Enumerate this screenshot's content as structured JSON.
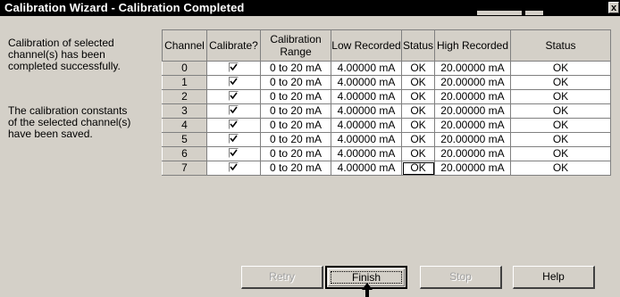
{
  "window": {
    "title": "Calibration Wizard - Calibration Completed",
    "close_glyph": "x"
  },
  "description": {
    "completed": "Calibration of selected\nchannel(s) has been\ncompleted successfully.",
    "saved": "The calibration constants\nof the selected channel(s)\nhave been saved."
  },
  "table": {
    "headers": [
      "Channel",
      "Calibrate?",
      "Calibration Range",
      "Low Recorded",
      "Status",
      "High Recorded",
      "Status"
    ],
    "rows": [
      {
        "channel": "0",
        "range": "0 to 20 mA",
        "low": "4.00000 mA",
        "low_status": "OK",
        "high": "20.00000 mA",
        "high_status": "OK"
      },
      {
        "channel": "1",
        "range": "0 to 20 mA",
        "low": "4.00000 mA",
        "low_status": "OK",
        "high": "20.00000 mA",
        "high_status": "OK"
      },
      {
        "channel": "2",
        "range": "0 to 20 mA",
        "low": "4.00000 mA",
        "low_status": "OK",
        "high": "20.00000 mA",
        "high_status": "OK"
      },
      {
        "channel": "3",
        "range": "0 to 20 mA",
        "low": "4.00000 mA",
        "low_status": "OK",
        "high": "20.00000 mA",
        "high_status": "OK"
      },
      {
        "channel": "4",
        "range": "0 to 20 mA",
        "low": "4.00000 mA",
        "low_status": "OK",
        "high": "20.00000 mA",
        "high_status": "OK"
      },
      {
        "channel": "5",
        "range": "0 to 20 mA",
        "low": "4.00000 mA",
        "low_status": "OK",
        "high": "20.00000 mA",
        "high_status": "OK"
      },
      {
        "channel": "6",
        "range": "0 to 20 mA",
        "low": "4.00000 mA",
        "low_status": "OK",
        "high": "20.00000 mA",
        "high_status": "OK"
      },
      {
        "channel": "7",
        "range": "0 to 20 mA",
        "low": "4.00000 mA",
        "low_status": "OK",
        "high": "20.00000 mA",
        "high_status": "OK"
      }
    ]
  },
  "buttons": {
    "retry": "Retry",
    "finish": "Finish",
    "stop": "Stop",
    "help": "Help"
  },
  "icons": {
    "checkbox": "checkmark-icon",
    "pointer": "arrow-pointer-icon"
  },
  "colors": {
    "title_bar": "#000000",
    "face": "#d4d0c8",
    "grid_background": "#ffffff"
  }
}
